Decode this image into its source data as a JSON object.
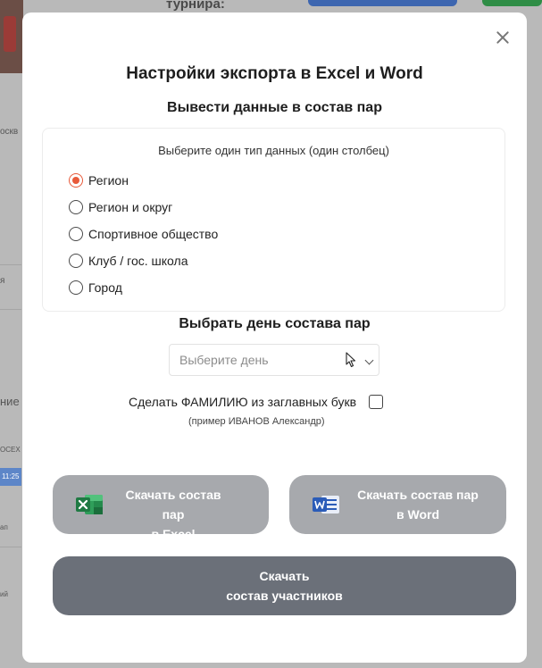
{
  "background": {
    "header_word": "турнира:",
    "side_texts": [
      "оскв",
      "я",
      "ние",
      "OCEX",
      "11:25",
      "ап",
      "ий"
    ]
  },
  "modal": {
    "title": "Настройки экспорта в Excel и Word",
    "subtitle": "Вывести данные в состав пар",
    "panel_hint": "Выберите один тип данных (один столбец)",
    "options": [
      {
        "label": "Регион",
        "checked": true
      },
      {
        "label": "Регион и округ",
        "checked": false
      },
      {
        "label": "Спортивное общество",
        "checked": false
      },
      {
        "label": "Клуб / гос. школа",
        "checked": false
      },
      {
        "label": "Город",
        "checked": false
      }
    ],
    "day_title": "Выбрать день состава пар",
    "day_select": {
      "placeholder": "Выберите день",
      "value": ""
    },
    "caps_label": "Сделать ФАМИЛИЮ из заглавных букв",
    "caps_checked": false,
    "caps_hint": "(пример ИВАНОВ Александр)",
    "btn_excel": {
      "line1": "Скачать состав пар",
      "line2": "в Excel",
      "icon": "excel-icon"
    },
    "btn_word": {
      "line1": "Скачать состав пар",
      "line2": "в Word",
      "icon": "word-icon"
    },
    "btn_all": {
      "line1": "Скачать",
      "line2": "состав участников"
    }
  },
  "colors": {
    "accent_radio": "#e85a3a",
    "button_light": "#a7a9ad",
    "button_dark": "#6b7079",
    "excel_green": "#1f7a43",
    "word_blue": "#2b5cb8"
  }
}
